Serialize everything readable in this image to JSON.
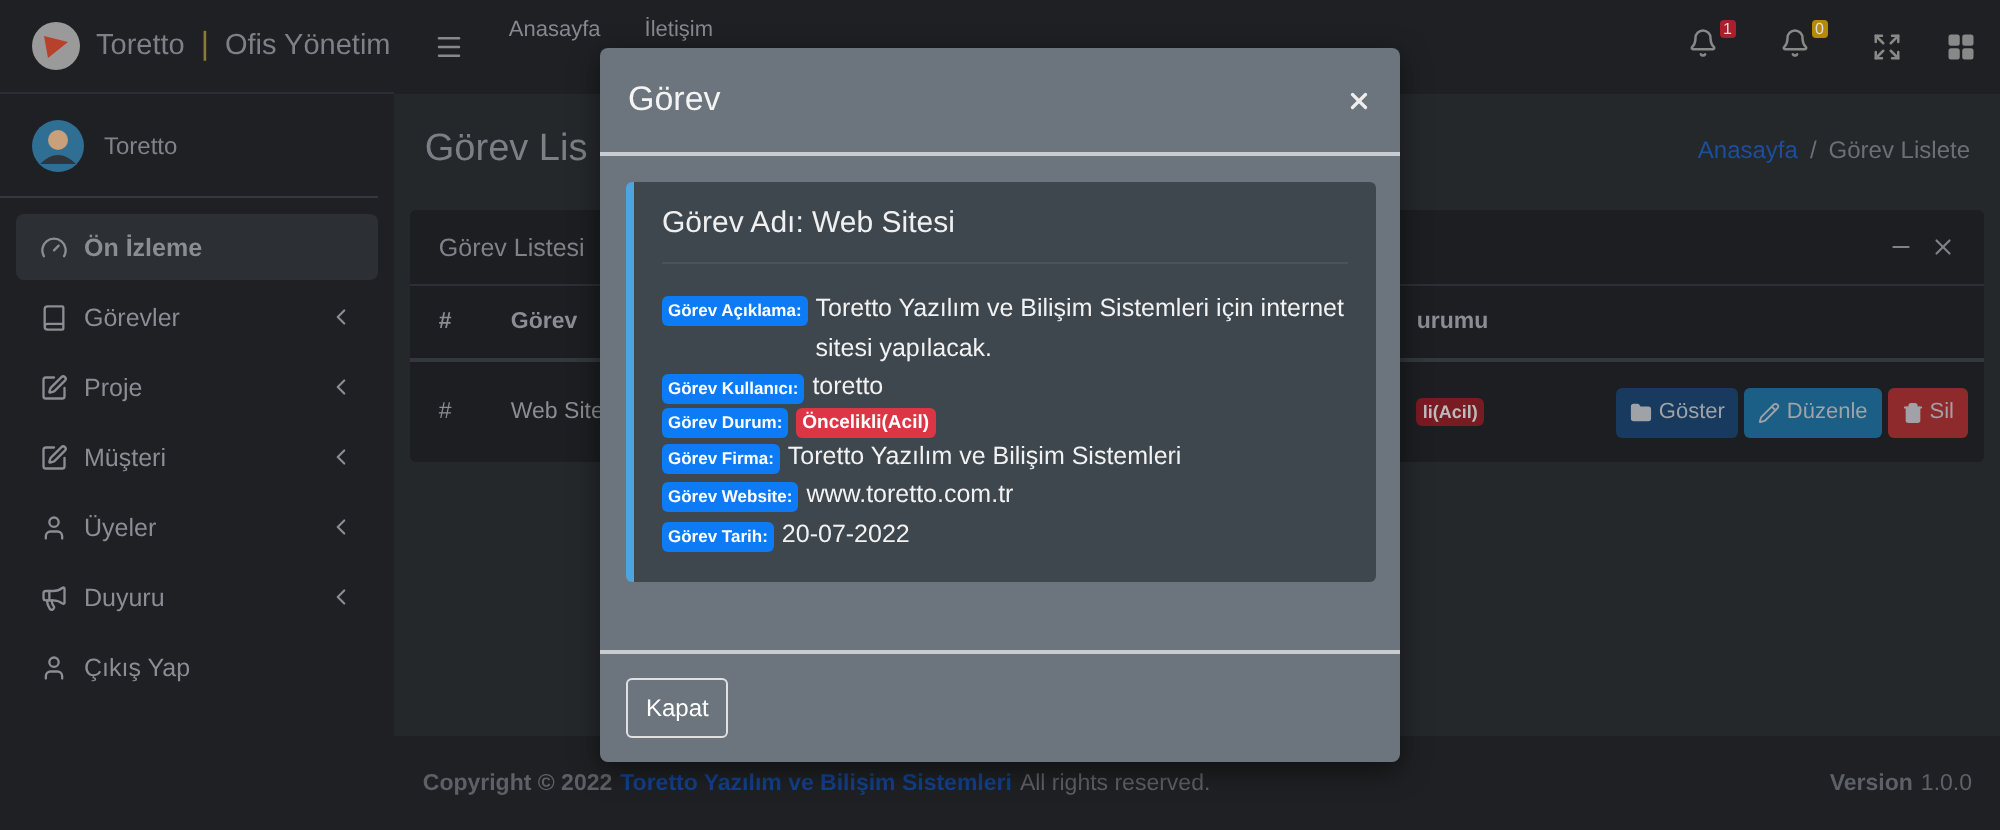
{
  "brand": {
    "name": "Toretto",
    "separator": "|",
    "subtitle": "Ofis Yönetim"
  },
  "user": {
    "name": "Toretto"
  },
  "sidebar": {
    "items": [
      {
        "label": "Ön İzleme",
        "kind": "gauge",
        "selected": true,
        "expandable": false
      },
      {
        "label": "Görevler",
        "kind": "book",
        "selected": false,
        "expandable": true
      },
      {
        "label": "Proje",
        "kind": "edit",
        "selected": false,
        "expandable": true
      },
      {
        "label": "Müşteri",
        "kind": "edit",
        "selected": false,
        "expandable": true
      },
      {
        "label": "Üyeler",
        "kind": "user",
        "selected": false,
        "expandable": true
      },
      {
        "label": "Duyuru",
        "kind": "megaphone",
        "selected": false,
        "expandable": true
      },
      {
        "label": "Çıkış Yap",
        "kind": "user",
        "selected": false,
        "expandable": false
      }
    ]
  },
  "navbar": {
    "links": [
      "Anasayfa",
      "İletişim"
    ],
    "notifications": [
      {
        "count": "1",
        "color": "#a8202e"
      },
      {
        "count": "0",
        "color": "#b58a05"
      }
    ]
  },
  "page": {
    "title": "Görev Lis",
    "breadcrumb": [
      "Anasayfa",
      "/",
      "Görev Lislete"
    ]
  },
  "card": {
    "title": "Görev Listesi",
    "table": {
      "columns": [
        "#",
        "Görev",
        "urumu"
      ],
      "rows": [
        {
          "cells": [
            "#",
            "Web Site"
          ],
          "status": "li(Acil)",
          "actions": [
            {
              "kind": "show",
              "label": "Göster"
            },
            {
              "kind": "edit",
              "label": "Düzenle"
            },
            {
              "kind": "delete",
              "label": "Sil"
            }
          ]
        }
      ]
    }
  },
  "modal": {
    "title": "Görev",
    "heading": "Görev Adı: Web Sitesi",
    "fields": [
      {
        "label": "Görev Açıklama:",
        "value": "Toretto Yazılım ve Bilişim Sistemleri için internet sitesi yapılacak.",
        "kind": "text"
      },
      {
        "label": "Görev Kullanıcı:",
        "value": "toretto",
        "kind": "text"
      },
      {
        "label": "Görev Durum:",
        "value": "Öncelikli(Acil)",
        "kind": "badge"
      },
      {
        "label": "Görev Firma:",
        "value": "Toretto Yazılım ve Bilişim Sistemleri",
        "kind": "text"
      },
      {
        "label": "Görev Website:",
        "value": "www.toretto.com.tr",
        "kind": "text"
      },
      {
        "label": "Görev Tarih:",
        "value": "20-07-2022",
        "kind": "text"
      }
    ],
    "close_button": "Kapat"
  },
  "footer": {
    "copyright": "Copyright © 2022",
    "company": "Toretto Yazılım ve Bilişim Sistemleri",
    "rights": "All rights reserved.",
    "version_label": "Version",
    "version": "1.0.0"
  }
}
